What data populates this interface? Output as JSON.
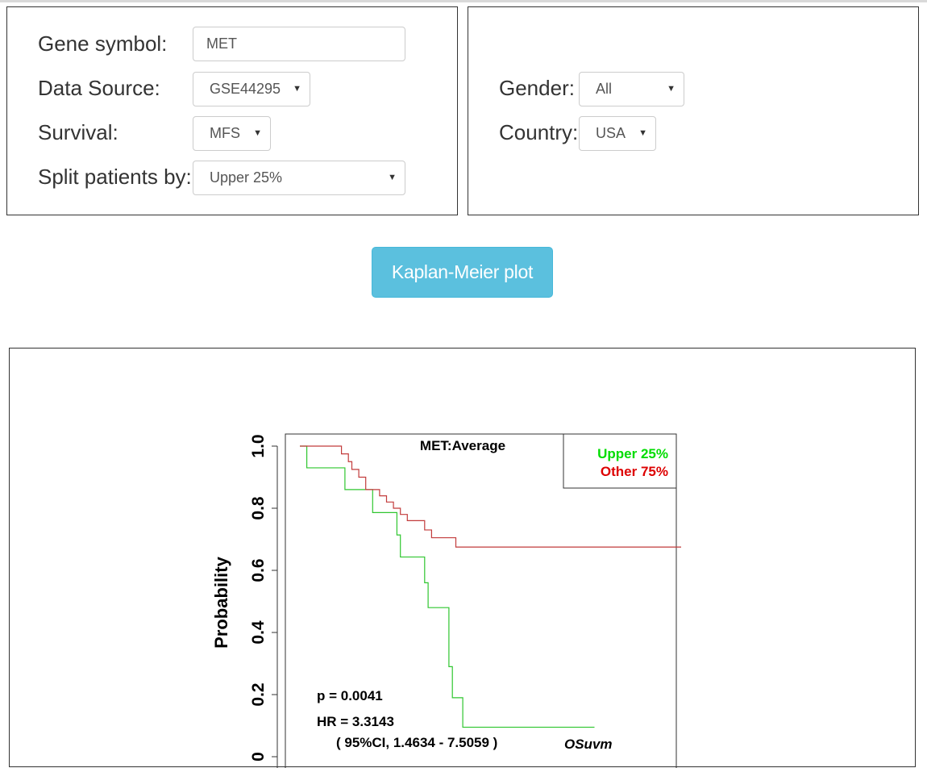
{
  "form_left": {
    "gene_label": "Gene symbol:",
    "gene_value": "MET",
    "source_label": "Data Source:",
    "source_value": "GSE44295",
    "survival_label": "Survival:",
    "survival_value": "MFS",
    "split_label": "Split patients by:",
    "split_value": "Upper 25%"
  },
  "form_right": {
    "gender_label": "Gender:",
    "gender_value": "All",
    "country_label": "Country:",
    "country_value": "USA"
  },
  "action": {
    "button_label": "Kaplan-Meier plot"
  },
  "icons": {
    "dropdown": "caret-down-icon"
  },
  "chart_data": {
    "type": "line",
    "title": "MET:Average",
    "ylabel": "Probability",
    "ylim": [
      0,
      1.0
    ],
    "yticks": [
      "1.0",
      "0.8",
      "0.6",
      "0.4",
      "0.2",
      "0"
    ],
    "legend": {
      "placement": "top-right",
      "entries": [
        {
          "label": "Upper 25%",
          "color": "#00dd00"
        },
        {
          "label": "Other  75%",
          "color": "#dd0000"
        }
      ]
    },
    "annotations": {
      "p_value": "p = 0.0041",
      "hr": "HR = 3.3143",
      "ci": "( 95%CI, 1.4634 - 7.5059 )",
      "tag": "OSuvm"
    },
    "series": [
      {
        "name": "Upper 25%",
        "color": "#2fc62f",
        "steps": [
          [
            0.0,
            1.0
          ],
          [
            0.02,
            0.93
          ],
          [
            0.13,
            0.86
          ],
          [
            0.21,
            0.786
          ],
          [
            0.28,
            0.714
          ],
          [
            0.29,
            0.643
          ],
          [
            0.36,
            0.56
          ],
          [
            0.37,
            0.48
          ],
          [
            0.43,
            0.29
          ],
          [
            0.44,
            0.19
          ],
          [
            0.47,
            0.095
          ],
          [
            0.85,
            0.095
          ]
        ]
      },
      {
        "name": "Other  75%",
        "color": "#c23b3b",
        "steps": [
          [
            0.0,
            1.0
          ],
          [
            0.12,
            0.975
          ],
          [
            0.14,
            0.95
          ],
          [
            0.15,
            0.925
          ],
          [
            0.17,
            0.9
          ],
          [
            0.19,
            0.86
          ],
          [
            0.23,
            0.84
          ],
          [
            0.25,
            0.82
          ],
          [
            0.27,
            0.8
          ],
          [
            0.29,
            0.78
          ],
          [
            0.31,
            0.76
          ],
          [
            0.36,
            0.73
          ],
          [
            0.38,
            0.705
          ],
          [
            0.45,
            0.675
          ],
          [
            1.1,
            0.675
          ]
        ]
      }
    ]
  }
}
